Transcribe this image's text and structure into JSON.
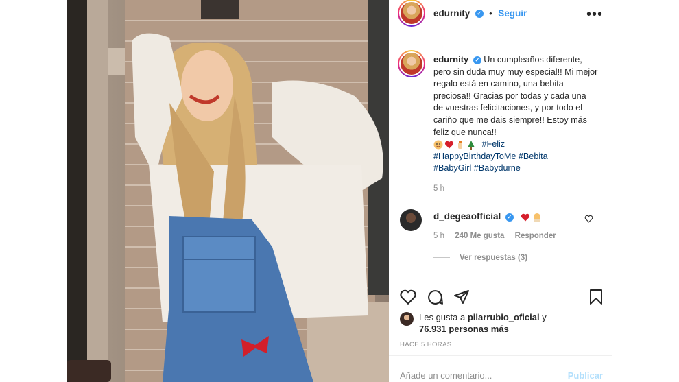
{
  "post": {
    "username": "edurnity",
    "follow_label": "Seguir",
    "more_label": "•••",
    "dot": "•",
    "verified_mark": "✓",
    "caption_text": "Un cumpleaños diferente, pero sin duda muy muy especial!! Mi mejor regalo está en camino, una bebita preciosa!! Gracias por todas y cada una de vuestras felicitaciones, y por todo el cariño que me dais siempre!! Estoy más feliz que nunca!!",
    "hashtags": [
      "#Feliz",
      "#HappyBirthdayToMe",
      "#Bebita",
      "#BabyGirl",
      "#Babydurne"
    ],
    "caption_emojis": [
      "baby-face-emoji",
      "heart-emoji",
      "bottle-emoji",
      "tree-emoji"
    ],
    "caption_time": "5 h"
  },
  "comment": {
    "username": "d_degeaofficial",
    "emojis": [
      "heart-emoji",
      "baby-emoji"
    ],
    "time": "5 h",
    "likes": "240 Me gusta",
    "reply_label": "Responder",
    "view_replies": "Ver respuestas (3)"
  },
  "likes": {
    "prefix": "Les gusta a ",
    "user": "pilarrubio_oficial",
    "middle": " y",
    "count": "76.931 personas más"
  },
  "timestamp": "HACE 5 HORAS",
  "add_comment": {
    "placeholder": "Añade un comentario...",
    "publish": "Publicar"
  },
  "icons": {
    "like": "heart-icon",
    "comment": "comment-icon",
    "share": "share-icon",
    "save": "bookmark-icon"
  },
  "colors": {
    "accent": "#3897f0",
    "hashtag": "#00376b",
    "muted": "#8e8e8e",
    "publish_disabled": "#b2dffc",
    "heart": "#ed4956"
  }
}
